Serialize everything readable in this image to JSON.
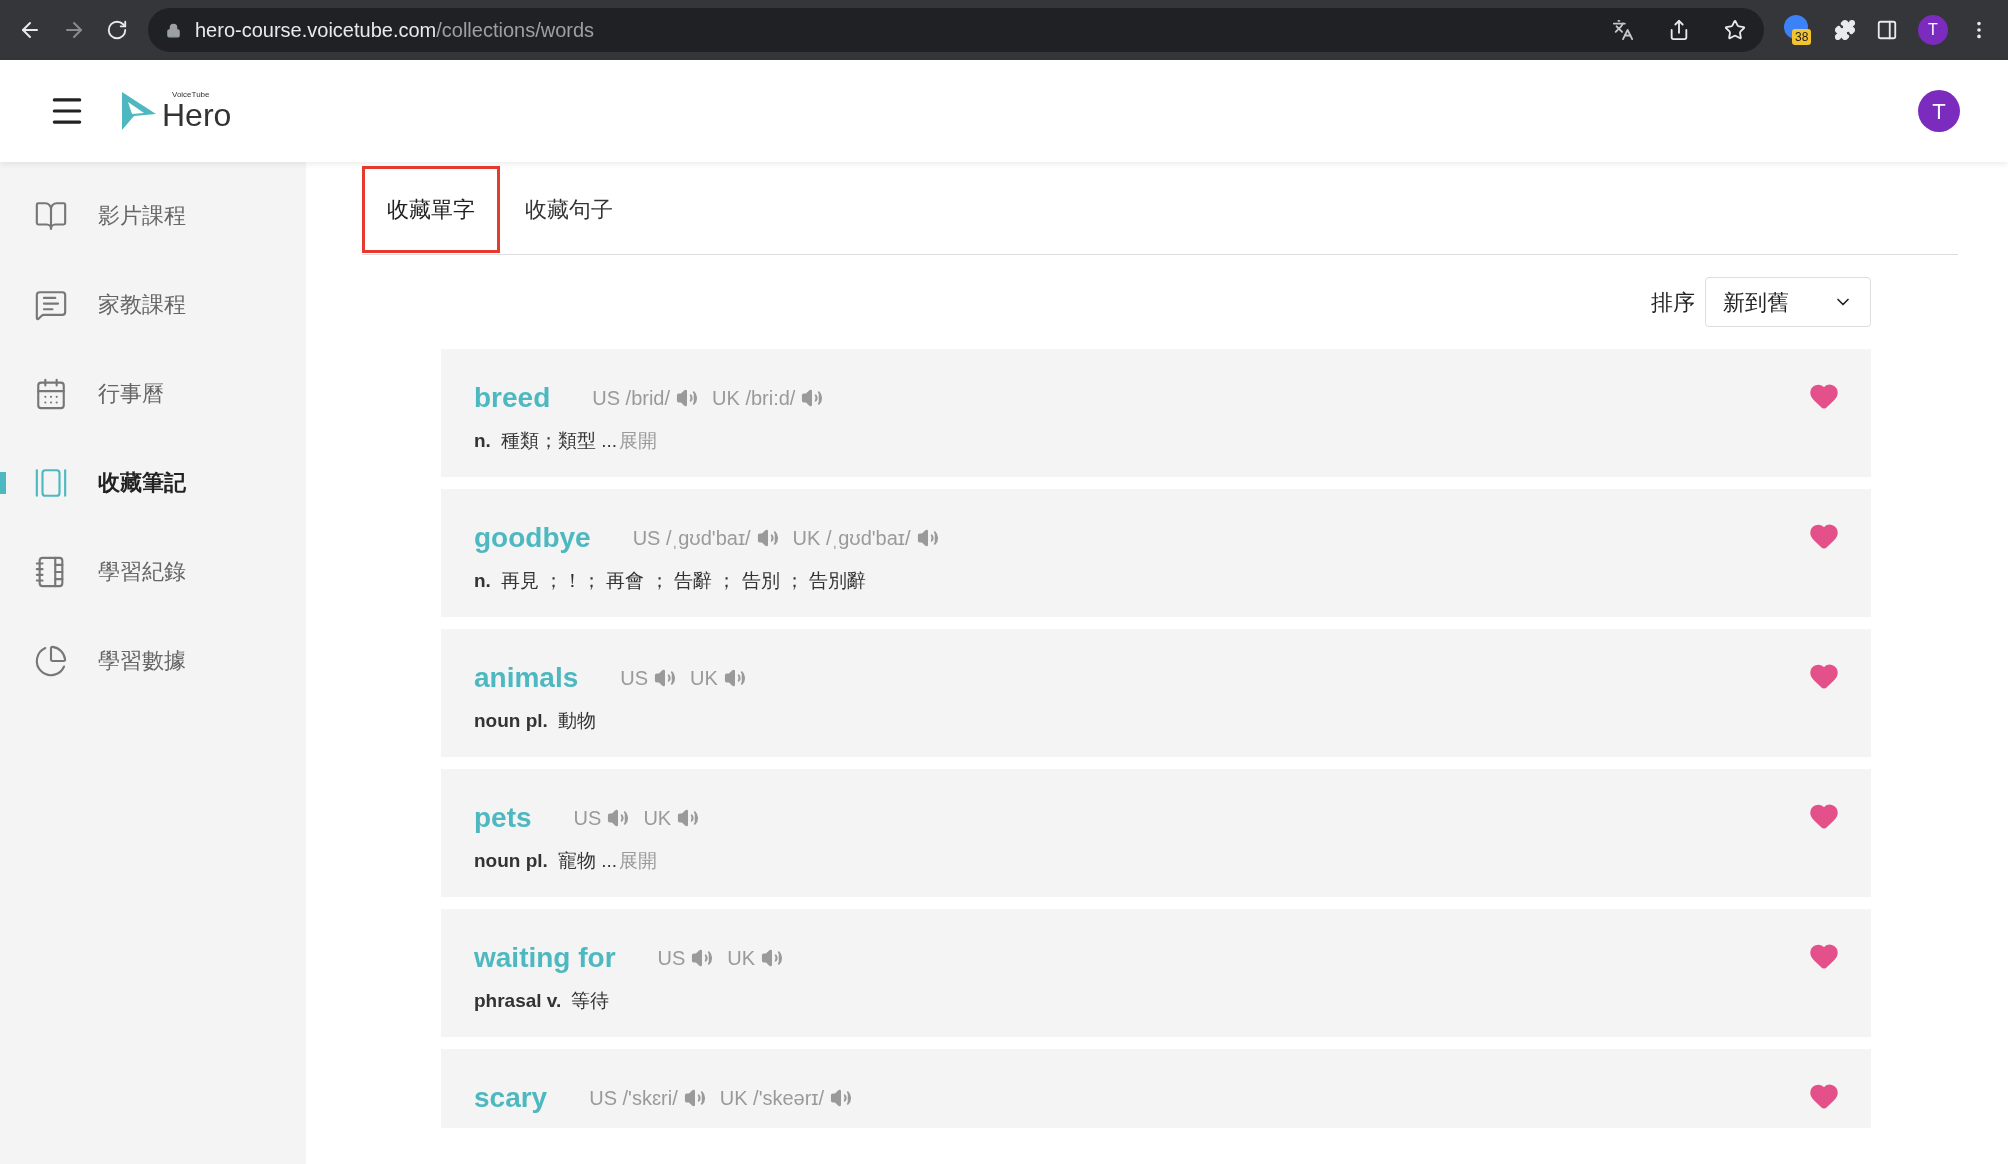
{
  "browser": {
    "url_host": "hero-course.voicetube.com",
    "url_path": "/collections/words",
    "extension_badge": "38",
    "profile_initial": "T"
  },
  "header": {
    "logo_small": "VoiceTube",
    "logo": "Hero",
    "avatar_initial": "T"
  },
  "sidebar": {
    "items": [
      {
        "label": "影片課程",
        "selected": false
      },
      {
        "label": "家教課程",
        "selected": false
      },
      {
        "label": "行事曆",
        "selected": false
      },
      {
        "label": "收藏筆記",
        "selected": true
      },
      {
        "label": "學習紀錄",
        "selected": false
      },
      {
        "label": "學習數據",
        "selected": false
      }
    ]
  },
  "tabs": [
    {
      "label": "收藏單字",
      "selected": true
    },
    {
      "label": "收藏句子",
      "selected": false
    }
  ],
  "sort": {
    "label": "排序",
    "value": "新到舊"
  },
  "words": [
    {
      "word": "breed",
      "us": "US /brid/",
      "uk": "UK /bri:d/",
      "pos": "n.",
      "meaning": "種類；類型 ...",
      "expand": "展開",
      "favorited": true
    },
    {
      "word": "goodbye",
      "us": "US /ˌɡʊd'baɪ/",
      "uk": "UK /ˌɡʊd'baɪ/",
      "pos": "n.",
      "meaning": "再見 ；！； 再會 ； 告辭 ； 告別 ； 告別辭",
      "favorited": true
    },
    {
      "word": "animals",
      "us": "US",
      "uk": "UK",
      "pos": "noun pl.",
      "meaning": "動物",
      "favorited": true
    },
    {
      "word": "pets",
      "us": "US",
      "uk": "UK",
      "pos": "noun pl.",
      "meaning": "寵物 ...",
      "expand": "展開",
      "favorited": true
    },
    {
      "word": "waiting for",
      "us": "US",
      "uk": "UK",
      "pos": "phrasal v.",
      "meaning": "等待",
      "favorited": true
    },
    {
      "word": "scary",
      "us": "US /'skɛri/",
      "uk": "UK /'skeərɪ/",
      "favorited": true
    }
  ]
}
